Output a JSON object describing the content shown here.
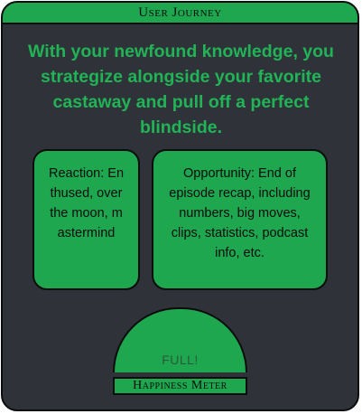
{
  "header": {
    "title": "User Journey"
  },
  "headline": "With your newfound knowledge, you strategize alongside your favorite castaway and pull off a perfect blindside.",
  "reaction": {
    "text": "Reaction: Enthused, over the moon, mastermind"
  },
  "opportunity": {
    "text": "Opportunity: End of episode recap, including numbers, big moves, clips, statistics, podcast info, etc."
  },
  "meter": {
    "value": "FULL!",
    "label": "Happiness Meter",
    "fill_fraction": 1.0
  },
  "colors": {
    "background": "#2f3238",
    "accent": "#1fa750",
    "headline": "#21b457",
    "outline": "#0b0c0d"
  }
}
